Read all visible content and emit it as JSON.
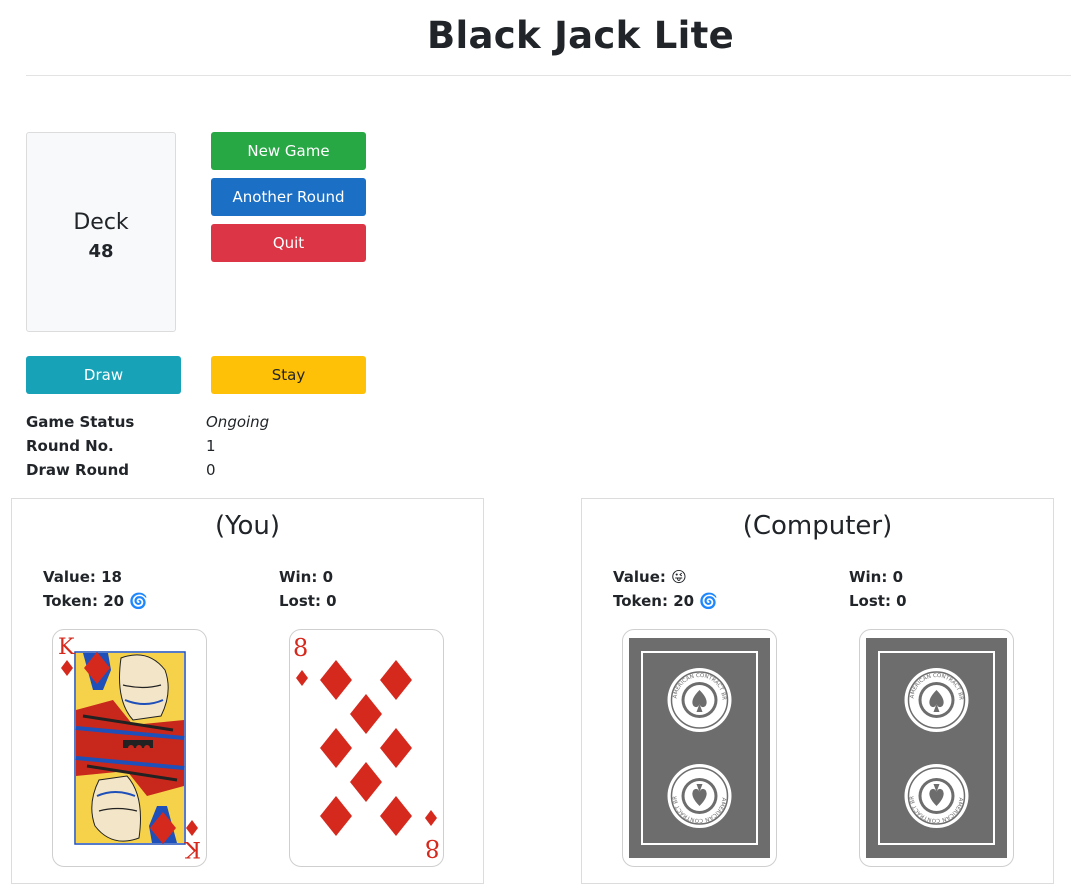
{
  "title": "Black Jack Lite",
  "deck": {
    "label": "Deck",
    "count": "48"
  },
  "buttons": {
    "new_game": "New Game",
    "another_round": "Another Round",
    "quit": "Quit",
    "draw": "Draw",
    "stay": "Stay"
  },
  "status": {
    "game_status_label": "Game Status",
    "game_status_value": "Ongoing",
    "round_no_label": "Round No.",
    "round_no_value": "1",
    "draw_round_label": "Draw Round",
    "draw_round_value": "0"
  },
  "player": {
    "title": "(You)",
    "value": "Value: 18",
    "token": "Token: 20 🌀",
    "win": "Win: 0",
    "lost": "Lost: 0",
    "cards": [
      {
        "rank": "K",
        "suit": "diamonds"
      },
      {
        "rank": "8",
        "suit": "diamonds"
      }
    ]
  },
  "computer": {
    "title": "(Computer)",
    "value": "Value: 😜",
    "token": "Token: 20 🌀",
    "win": "Win: 0",
    "lost": "Lost: 0",
    "cards": [
      {
        "face": "down",
        "back_text": "AMERICAN CONTRACT BRIDGE LEAGUE"
      },
      {
        "face": "down",
        "back_text": "AMERICAN CONTRACT BRIDGE LEAGUE"
      }
    ]
  },
  "colors": {
    "suit_red": "#d6291d",
    "card_back": "#6d6d6d",
    "new_game": "#28a745",
    "another_round": "#1b6fc4",
    "quit": "#dc3545",
    "draw": "#17a2b8",
    "stay": "#ffc107"
  }
}
